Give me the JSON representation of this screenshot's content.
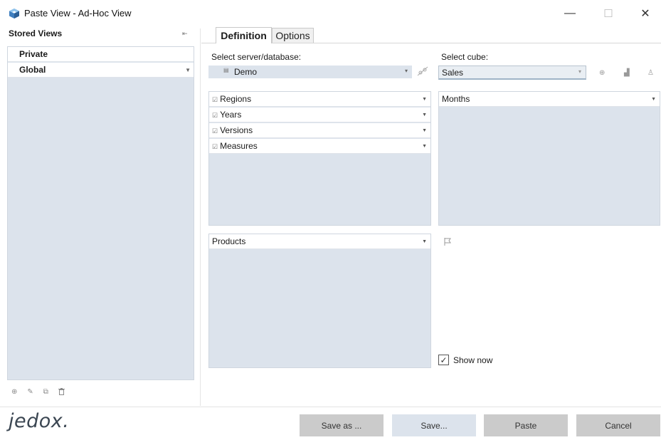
{
  "window": {
    "title": "Paste View - Ad-Hoc View",
    "app_icon": "jedox-cube-icon",
    "controls": {
      "minimize": "—",
      "maximize": "☐",
      "close": "✕"
    }
  },
  "sidebar": {
    "title": "Stored Views",
    "pin_icon": "pin-icon",
    "items": [
      {
        "label": "Private"
      },
      {
        "label": "Global"
      }
    ],
    "tools": [
      {
        "icon": "add-icon",
        "glyph": "⊕"
      },
      {
        "icon": "edit-icon",
        "glyph": "✎"
      },
      {
        "icon": "copy-icon",
        "glyph": "⧉"
      },
      {
        "icon": "delete-icon",
        "glyph": "🗑"
      }
    ]
  },
  "tabs": [
    {
      "label": "Definition",
      "active": true
    },
    {
      "label": "Options",
      "active": false
    }
  ],
  "definition": {
    "server_label": "Select server/database:",
    "server_value": "Demo",
    "cube_label": "Select cube:",
    "cube_value": "Sales",
    "row_dimensions": [
      "Regions",
      "Years",
      "Versions",
      "Measures"
    ],
    "column_dimensions": [
      "Months"
    ],
    "page_dimensions": [
      "Products"
    ],
    "show_now_label": "Show now",
    "show_now_checked": true
  },
  "footer": {
    "logo": "jedox.",
    "buttons": {
      "save_as": "Save as ...",
      "save": "Save...",
      "paste": "Paste",
      "cancel": "Cancel"
    }
  },
  "colors": {
    "panel_bg": "#dce3ec",
    "button_bg": "#cbcbcb",
    "logo": "#3b4652"
  }
}
